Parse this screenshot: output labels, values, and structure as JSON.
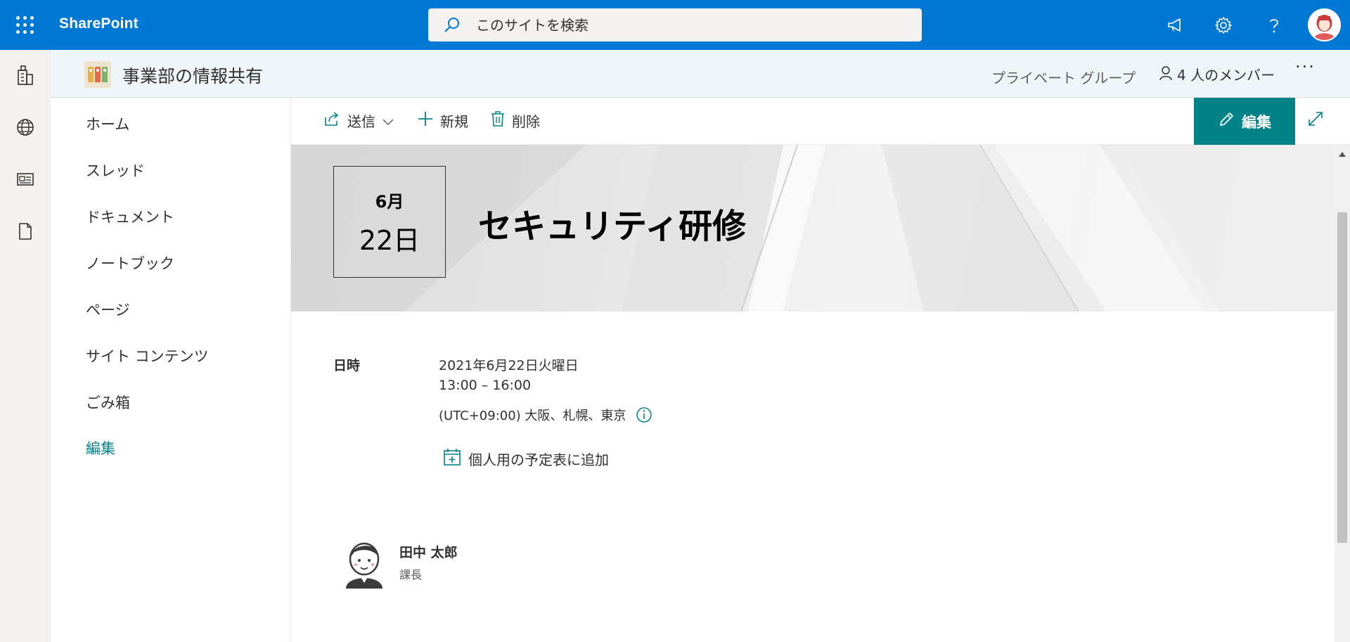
{
  "suite": {
    "brand": "SharePoint",
    "search_placeholder": "このサイトを検索"
  },
  "site": {
    "title": "事業部の情報共有",
    "privacy": "プライベート グループ",
    "members": "4 人のメンバー",
    "more": "···"
  },
  "nav": {
    "items": [
      {
        "label": "ホーム"
      },
      {
        "label": "スレッド"
      },
      {
        "label": "ドキュメント"
      },
      {
        "label": "ノートブック"
      },
      {
        "label": "ページ"
      },
      {
        "label": "サイト コンテンツ"
      },
      {
        "label": "ごみ箱"
      },
      {
        "label": "編集"
      }
    ]
  },
  "commands": {
    "send": "送信",
    "new": "新規",
    "delete": "削除",
    "edit": "編集"
  },
  "event": {
    "month": "6月",
    "day": "22日",
    "title": "セキュリティ研修",
    "when_label": "日時",
    "date": "2021年6月22日火曜日",
    "time": "13:00 – 16:00",
    "timezone": "(UTC+09:00) 大阪、札幌、東京",
    "add_calendar": "個人用の予定表に追加"
  },
  "person": {
    "name": "田中 太郎",
    "role": "課長"
  },
  "colors": {
    "suite_bar": "#0078d4",
    "accent": "#038387",
    "site_header": "#eef6f9"
  }
}
